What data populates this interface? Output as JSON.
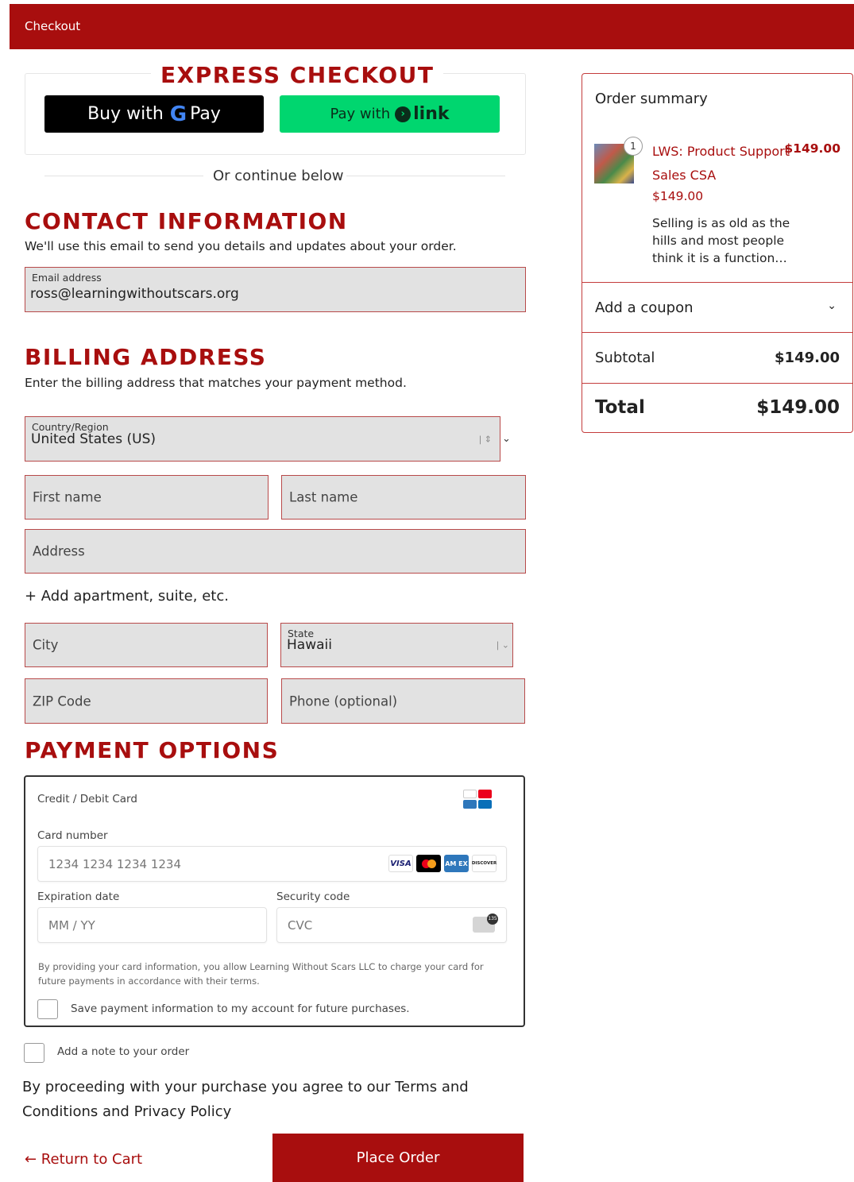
{
  "header": {
    "title": "Checkout"
  },
  "express": {
    "title": "EXPRESS CHECKOUT",
    "gpay_prefix": "Buy with",
    "gpay_g": "G",
    "gpay_pay": "Pay",
    "link_prefix": "Pay with",
    "link_word": "link",
    "or_text": "Or continue below"
  },
  "contact": {
    "title": "CONTACT INFORMATION",
    "subtitle": "We'll use this email to send you details and updates about your order.",
    "email_label": "Email address",
    "email_value": "ross@learningwithoutscars.org"
  },
  "billing": {
    "title": "BILLING ADDRESS",
    "subtitle": "Enter the billing address that matches your payment method.",
    "country_label": "Country/Region",
    "country_value": "United States (US)",
    "first_name": "First name",
    "last_name": "Last name",
    "address": "Address",
    "add_apt": "+ Add apartment, suite, etc.",
    "city": "City",
    "state_label": "State",
    "state_value": "Hawaii",
    "zip": "ZIP Code",
    "phone": "Phone (optional)"
  },
  "payment": {
    "title": "PAYMENT OPTIONS",
    "method": "Credit / Debit Card",
    "card_number_label": "Card number",
    "card_number_placeholder": "1234 1234 1234 1234",
    "expiry_label": "Expiration date",
    "expiry_placeholder": "MM / YY",
    "cvc_label": "Security code",
    "cvc_placeholder": "CVC",
    "consent": "By providing your card information, you allow Learning Without Scars LLC to charge your card for future payments in accordance with their terms.",
    "save_label": "Save payment information to my account for future purchases.",
    "logos": {
      "visa": "VISA",
      "amex": "AM EX",
      "discover": "DISCOVER"
    }
  },
  "order_note": "Add a note to your order",
  "agreement": "By proceeding with your purchase you agree to our Terms and Conditions and Privacy Policy",
  "actions": {
    "return": "← Return to Cart",
    "place_order": "Place Order"
  },
  "summary": {
    "title": "Order summary",
    "item": {
      "qty": "1",
      "name": "LWS: Product Support Sales CSA",
      "price_right": "$149.00",
      "price": "$149.00",
      "description": "Selling is as old as the hills and most people think it is a function…"
    },
    "coupon": "Add a coupon",
    "subtotal_label": "Subtotal",
    "subtotal_value": "$149.00",
    "total_label": "Total",
    "total_value": "$149.00"
  },
  "colors": {
    "brand": "#a80e0e",
    "link_green": "#00d66f",
    "field_bg": "#e2e2e2"
  }
}
